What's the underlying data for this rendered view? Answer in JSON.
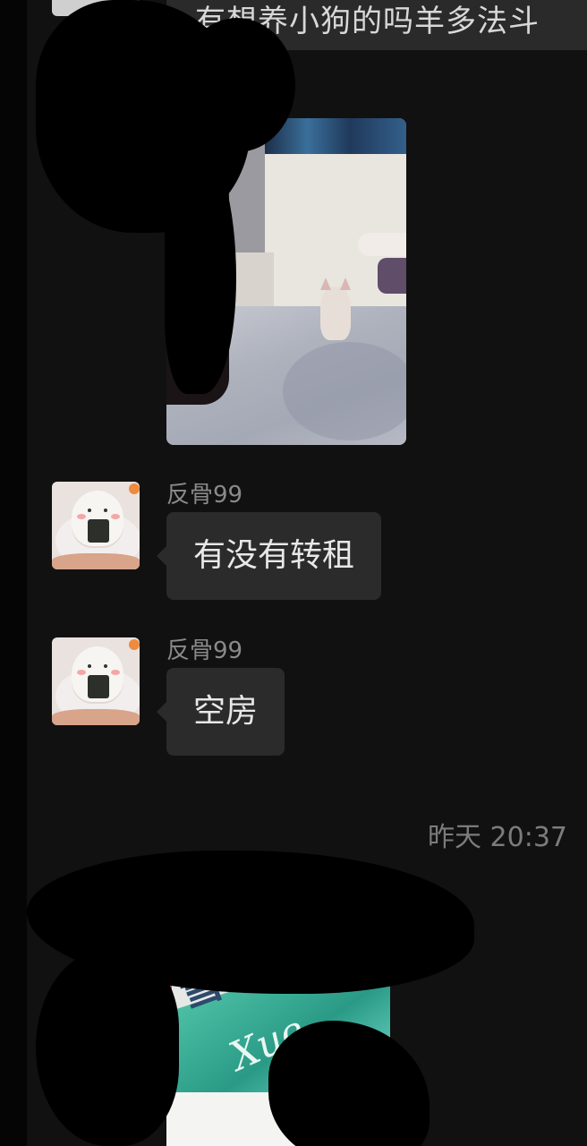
{
  "top_message": {
    "text": "有想养小狗的吗羊多法斗"
  },
  "messages": [
    {
      "sender": "反骨99",
      "text": "有没有转租"
    },
    {
      "sender": "反骨99",
      "text": "空房"
    }
  ],
  "timestamp": "昨天 20:37",
  "bottom_image": {
    "visible_text_cn": "雪",
    "visible_text_latin": "Xue"
  }
}
